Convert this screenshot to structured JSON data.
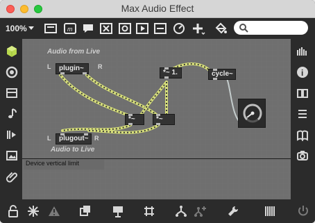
{
  "window": {
    "title": "Max Audio Effect"
  },
  "toolbar": {
    "zoom_label": "100%",
    "search_placeholder": ""
  },
  "canvas": {
    "comments": {
      "audio_from_live": "Audio from Live",
      "audio_to_live": "Audio to Live",
      "l_in": "L",
      "r_in": "R",
      "l_out": "L",
      "r_out": "R"
    },
    "objects": {
      "plugin": "plugin~",
      "plugout": "plugout~",
      "mul_left": "*~",
      "mul_right": "*~",
      "mul_1": "*~ 1.",
      "cycle": "cycle~"
    },
    "device_limit_label": "Device vertical limit"
  },
  "icons": {
    "left_sidebar": [
      "cube-icon",
      "circle-icon",
      "panel-icon",
      "music-note-icon",
      "play-list-icon",
      "image-icon",
      "paperclip-icon"
    ],
    "right_sidebar": [
      "meter-icon",
      "info-icon",
      "book-icon",
      "list-icon",
      "book-open-icon",
      "camera-icon"
    ],
    "bottom_bar": [
      "lock-icon",
      "snowflake-icon",
      "warning-icon",
      "copy-icon",
      "presentation-icon",
      "grid-icon",
      "hierarchy-icon",
      "add-hierarchy-icon",
      "wrench-icon",
      "meter-bars-icon",
      "power-icon"
    ]
  },
  "colors": {
    "canvas_bg": "#6f6f6f",
    "patchcord_audio": "#d7df7a",
    "patchcord_dash": "#3a3a3a",
    "patchcord_signal": "#bfc6c6",
    "toolbar_bg": "#2b2b2b"
  }
}
